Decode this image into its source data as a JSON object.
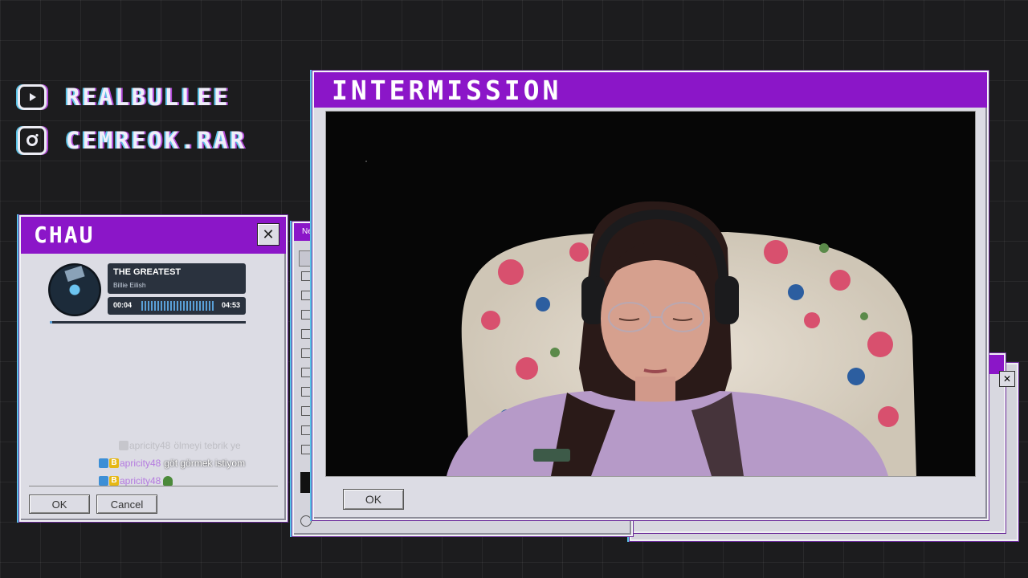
{
  "socials": {
    "youtube": {
      "icon": "youtube-icon",
      "handle": "REALBULLEE"
    },
    "instagram": {
      "icon": "instagram-icon",
      "handle": "CEMREOK.RAR"
    }
  },
  "chat_window": {
    "title": "CHAU",
    "close_glyph": "✕",
    "player": {
      "song": "THE GREATEST",
      "artist": "Billie Eilish",
      "elapsed": "00:04",
      "duration": "04:53",
      "progress": 0.014
    },
    "messages": [
      {
        "user": "apricity48",
        "text": "ölmeyi tebrik ye",
        "faded": true
      },
      {
        "user": "apricity48",
        "text": "göt görmek istiyom",
        "faded": false
      },
      {
        "user": "apricity48",
        "text": "",
        "emote": "frog-emote",
        "faded": false
      }
    ],
    "ok_label": "OK",
    "cancel_label": "Cancel"
  },
  "paint_window": {
    "title_fragment": "Ne"
  },
  "main_window": {
    "title": "INTERMISSION",
    "ok_label": "OK"
  },
  "colors": {
    "accent": "#8b16c8",
    "window_bg": "#dcdce4",
    "cyan_glitch": "#59c3e8",
    "page_bg": "#1c1c1e"
  }
}
